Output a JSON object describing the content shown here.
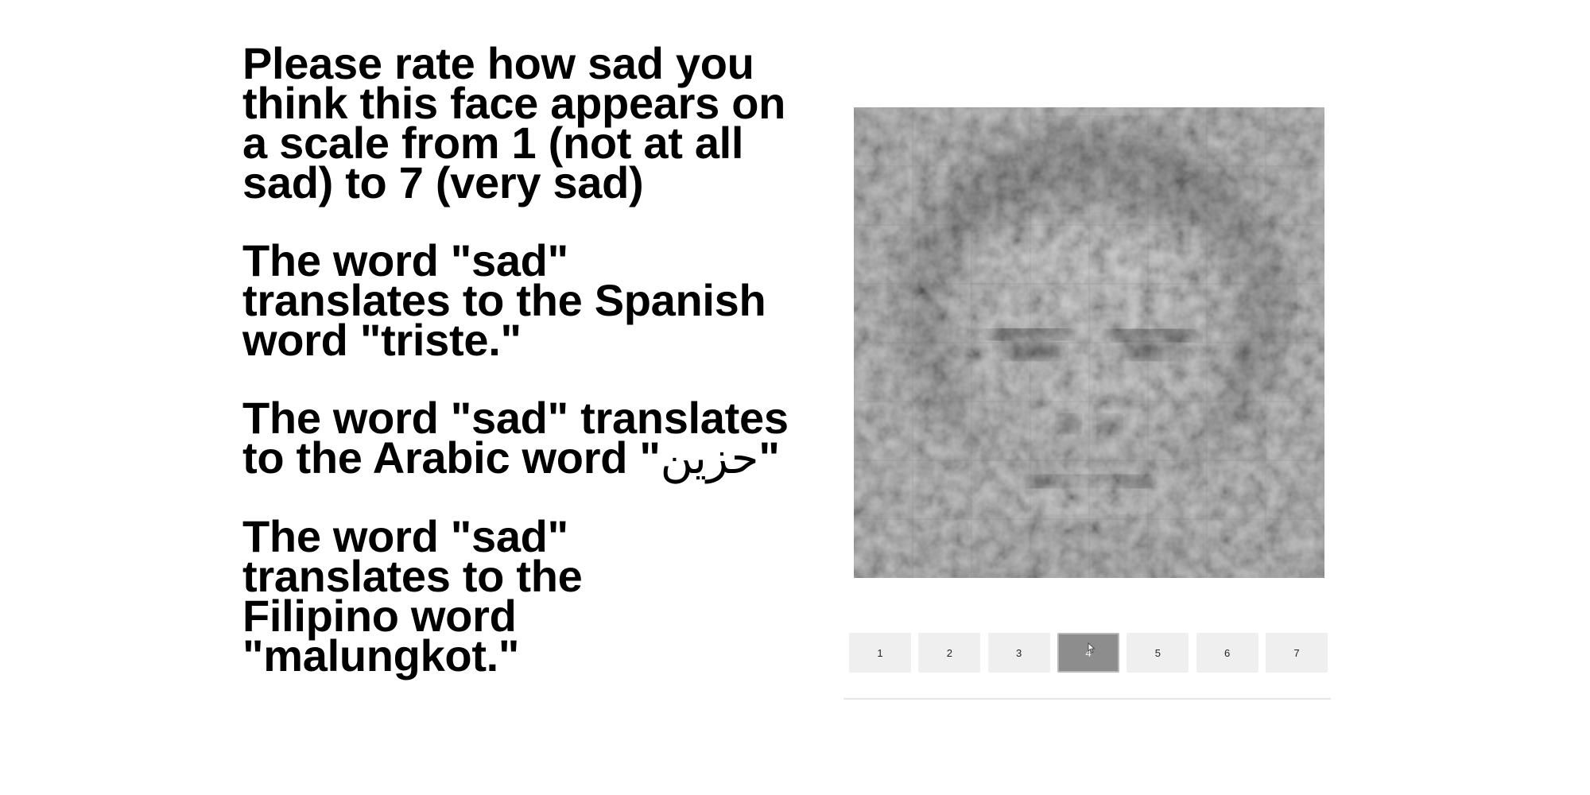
{
  "instructions": {
    "prompt": "Please rate how sad you think this face appears on a scale from 1 (not at all sad) to 7 (very sad)",
    "spanish_prefix": "The word \"sad\" translates to the Spanish word \"triste.\"",
    "arabic_prefix": "The word \"sad\" translates to the Arabic word \"",
    "arabic_word": "حزين",
    "arabic_suffix": "\"",
    "filipino": "The word \"sad\" translates to the Filipino word \"malungkot.\""
  },
  "stimulus": {
    "description_icon": "face-image"
  },
  "rating": {
    "options": [
      "1",
      "2",
      "3",
      "4",
      "5",
      "6",
      "7"
    ],
    "selected": "4"
  },
  "colors": {
    "button_bg": "#efefef",
    "button_selected_bg": "#8d8d8d",
    "divider": "#e6e6e6"
  }
}
